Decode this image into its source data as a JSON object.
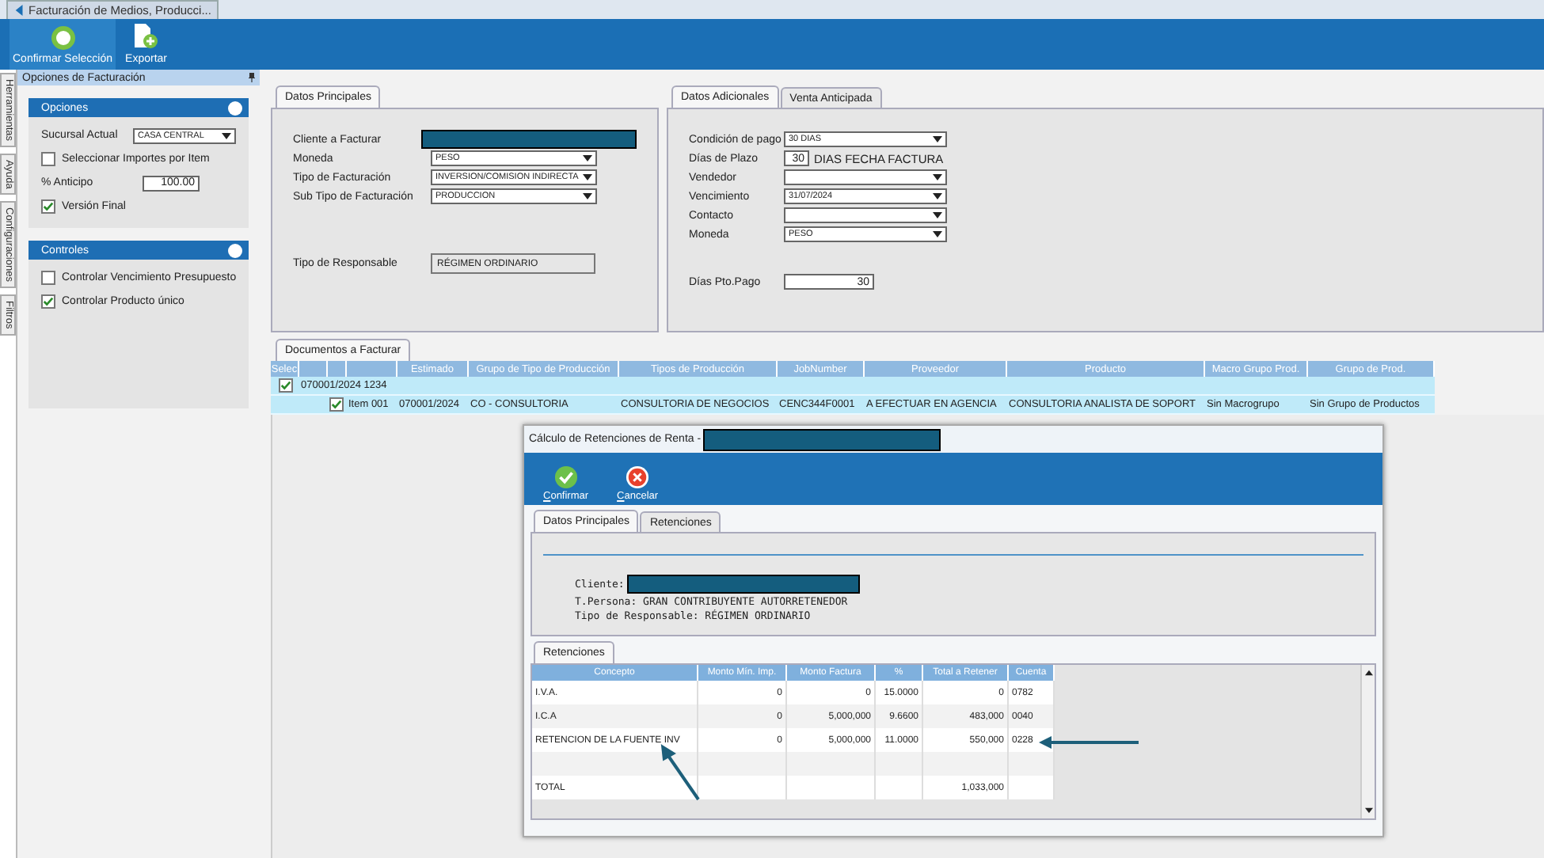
{
  "app_tab": {
    "title": "Facturación de Medios, Producci..."
  },
  "toolbar": [
    {
      "label": "Confirmar Selección",
      "kind": "accept"
    },
    {
      "label": "Exportar",
      "kind": "export"
    }
  ],
  "side_tabs": [
    "Herramientas",
    "Ayuda",
    "Configuraciones",
    "Filtros"
  ],
  "options_panel": {
    "title": "Opciones de Facturación",
    "groups": [
      {
        "title": "Opciones",
        "rows": [
          {
            "kind": "select",
            "label": "Sucursal Actual",
            "value": "CASA CENTRAL"
          },
          {
            "kind": "checkbox",
            "label": "Seleccionar Importes por Item",
            "checked": false
          },
          {
            "kind": "number",
            "label": "% Anticipo",
            "value": "100.00"
          },
          {
            "kind": "checkbox",
            "label": "Versión Final",
            "checked": true
          }
        ]
      },
      {
        "title": "Controles",
        "rows": [
          {
            "kind": "checkbox",
            "label": "Controlar Vencimiento Presupuesto",
            "checked": false
          },
          {
            "kind": "checkbox",
            "label": "Controlar Producto único",
            "checked": true
          }
        ]
      }
    ]
  },
  "main_panel": {
    "tabs": [
      {
        "label": "Datos Principales",
        "selected": true
      }
    ],
    "fields": [
      {
        "kind": "redacted",
        "label": "Cliente a Facturar"
      },
      {
        "kind": "select",
        "label": "Moneda",
        "value": "PESO"
      },
      {
        "kind": "select",
        "label": "Tipo de Facturación",
        "value": "INVERSION/COMISION INDIRECTA"
      },
      {
        "kind": "select",
        "label": "Sub Tipo de Facturación",
        "value": "PRODUCCION"
      },
      {
        "kind": "readonly",
        "label": "Tipo de Responsable",
        "value": "RÉGIMEN ORDINARIO"
      }
    ]
  },
  "extra_panel": {
    "tabs": [
      {
        "label": "Datos Adicionales",
        "selected": true
      },
      {
        "label": "Venta Anticipada",
        "selected": false
      }
    ],
    "fields": [
      {
        "kind": "select",
        "label": "Condición de pago",
        "value": "30 DIAS"
      },
      {
        "kind": "days",
        "label": "Días de Plazo",
        "value": "30",
        "note": "DIAS FECHA FACTURA"
      },
      {
        "kind": "select",
        "label": "Vendedor"
      },
      {
        "kind": "select",
        "label": "Vencimiento",
        "value": "31/07/2024"
      },
      {
        "kind": "select",
        "label": "Contacto"
      },
      {
        "kind": "select",
        "label": "Moneda",
        "value": "PESO"
      },
      {
        "kind": "number",
        "label": "Días Pto.Pago",
        "value": "30"
      }
    ]
  },
  "documents": {
    "tab": "Documentos a Facturar",
    "columns": [
      "Selec",
      "Estimado",
      "Grupo de Tipo de Producción",
      "Tipos de Producción",
      "JobNumber",
      "Proveedor",
      "Producto",
      "Macro Grupo Prod.",
      "Grupo de Prod."
    ],
    "group_row": {
      "checked": true,
      "label": "070001/2024 1234"
    },
    "items": [
      {
        "checked": true,
        "cells": [
          "Item 001",
          "070001/2024",
          "CO - CONSULTORIA",
          "CONSULTORIA DE NEGOCIOS",
          "CENC344F0001",
          "A EFECTUAR EN AGENCIA",
          "CONSULTORIA ANALISTA DE SOPORT",
          "Sin Macrogrupo",
          "Sin Grupo de Productos"
        ]
      }
    ]
  },
  "dialog": {
    "title": "Cálculo de Retenciones de Renta -",
    "toolbar": [
      {
        "label": "Confirmar",
        "kind": "confirm"
      },
      {
        "label": "Cancelar",
        "kind": "cancel"
      }
    ],
    "tabs": [
      {
        "label": "Datos Principales",
        "selected": true
      },
      {
        "label": "Retenciones",
        "selected": false
      }
    ],
    "info": [
      {
        "label": "Cliente:",
        "redacted": true
      },
      {
        "label": "T.Persona: GRAN CONTRIBUYENTE AUTORRETENEDOR",
        "redacted": false
      },
      {
        "label": "Tipo de Responsable: RÉGIMEN ORDINARIO",
        "redacted": false
      }
    ],
    "grid_tab": "Retenciones",
    "columns": [
      "Concepto",
      "Monto Mín. Imp.",
      "Monto Factura",
      "%",
      "Total a Retener",
      "Cuenta"
    ],
    "rows": [
      {
        "kind": "data",
        "cells": [
          "I.V.A.",
          "0",
          "0",
          "15.0000",
          "0",
          "0782"
        ]
      },
      {
        "kind": "data",
        "cells": [
          "I.C.A",
          "0",
          "5,000,000",
          "9.6600",
          "483,000",
          "0040"
        ]
      },
      {
        "kind": "data",
        "cells": [
          "RETENCION DE LA FUENTE INV",
          "0",
          "5,000,000",
          "11.0000",
          "550,000",
          "0228"
        ]
      },
      {
        "kind": "blank"
      },
      {
        "kind": "total",
        "cells": [
          "TOTAL",
          "1,033,000"
        ]
      }
    ]
  }
}
